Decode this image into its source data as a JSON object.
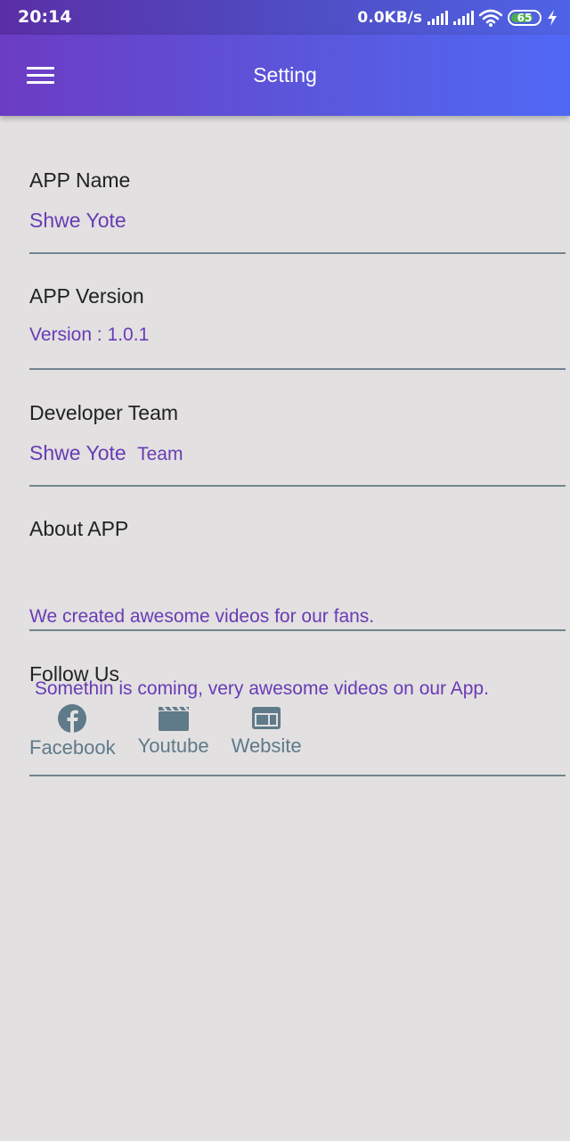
{
  "status_bar": {
    "time": "20:14",
    "net_speed": "0.0KB/s",
    "battery": "65"
  },
  "app_bar": {
    "title": "Setting",
    "menu_icon": "hamburger-menu-icon"
  },
  "sections": {
    "app_name": {
      "label": "APP Name",
      "value": "Shwe Yote"
    },
    "app_version": {
      "label": "APP Version",
      "value": "Version : 1.0.1"
    },
    "developer_team": {
      "label": "Developer Team",
      "value_main": "Shwe Yote",
      "value_suffix": "Team"
    },
    "about_app": {
      "label": "About APP",
      "line1": "We created awesome videos for our fans.",
      "line2": " Somethin is coming, very awesome videos on our App."
    },
    "follow_us": {
      "label": "Follow Us",
      "items": [
        {
          "label": "Facebook",
          "icon": "facebook-icon"
        },
        {
          "label": "Youtube",
          "icon": "movie-clapper-icon"
        },
        {
          "label": "Website",
          "icon": "web-browser-icon"
        }
      ]
    }
  },
  "colors": {
    "accent_text": "#6a3bb5",
    "divider": "#6f8590",
    "icon_gray": "#5f7a89",
    "background": "#e2e0e1",
    "battery_green": "#4caf50"
  }
}
